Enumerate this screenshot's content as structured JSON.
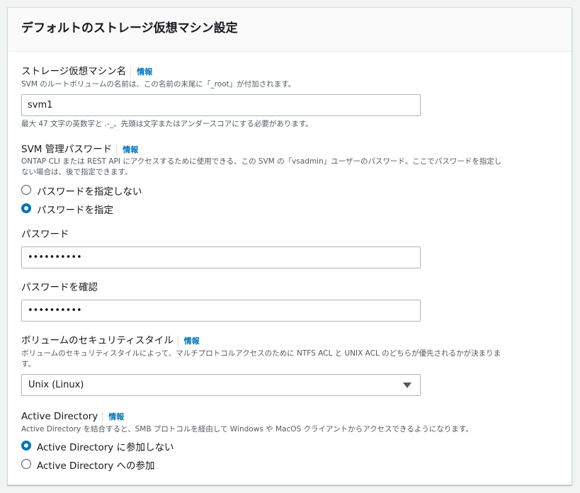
{
  "panel": {
    "title": "デフォルトのストレージ仮想マシン設定"
  },
  "svm_name": {
    "label": "ストレージ仮想マシン名",
    "info": "情報",
    "description": "SVM のルートボリュームの名前は、この名前の末尾に「_root」が付加されます。",
    "value": "svm1",
    "constraint": "最大 47 文字の英数字と .-_。先頭は文字またはアンダースコアにする必要があります。"
  },
  "admin_password": {
    "label": "SVM 管理パスワード",
    "info": "情報",
    "description_line1": "ONTAP CLI または REST API にアクセスするために使用できる、この SVM の「vsadmin」ユーザーのパスワード。ここでパスワードを指定し",
    "description_line2": "ない場合は、後で指定できます。",
    "options": [
      {
        "label": "パスワードを指定しない",
        "selected": false
      },
      {
        "label": "パスワードを指定",
        "selected": true
      }
    ],
    "password_label": "パスワード",
    "password_value": "••••••••••",
    "confirm_label": "パスワードを確認",
    "confirm_value": "••••••••••"
  },
  "security_style": {
    "label": "ボリュームのセキュリティスタイル",
    "info": "情報",
    "description_line1": "ボリュームのセキュリティスタイルによって、マルチプロトコルアクセスのために NTFS ACL と UNIX ACL のどちらが優先されるかが決まりま",
    "description_line2": "す。",
    "selected": "Unix (Linux)"
  },
  "active_directory": {
    "label": "Active Directory",
    "info": "情報",
    "description": "Active Directory を結合すると、SMB プロトコルを経由して Windows や MacOS クライアントからアクセスできるようになります。",
    "options": [
      {
        "label": "Active Directory に参加しない",
        "selected": true
      },
      {
        "label": "Active Directory への参加",
        "selected": false
      }
    ]
  },
  "colors": {
    "accent": "#0073bb",
    "text": "#16191f",
    "secondary_text": "#545b64",
    "border": "#aab7b8"
  }
}
